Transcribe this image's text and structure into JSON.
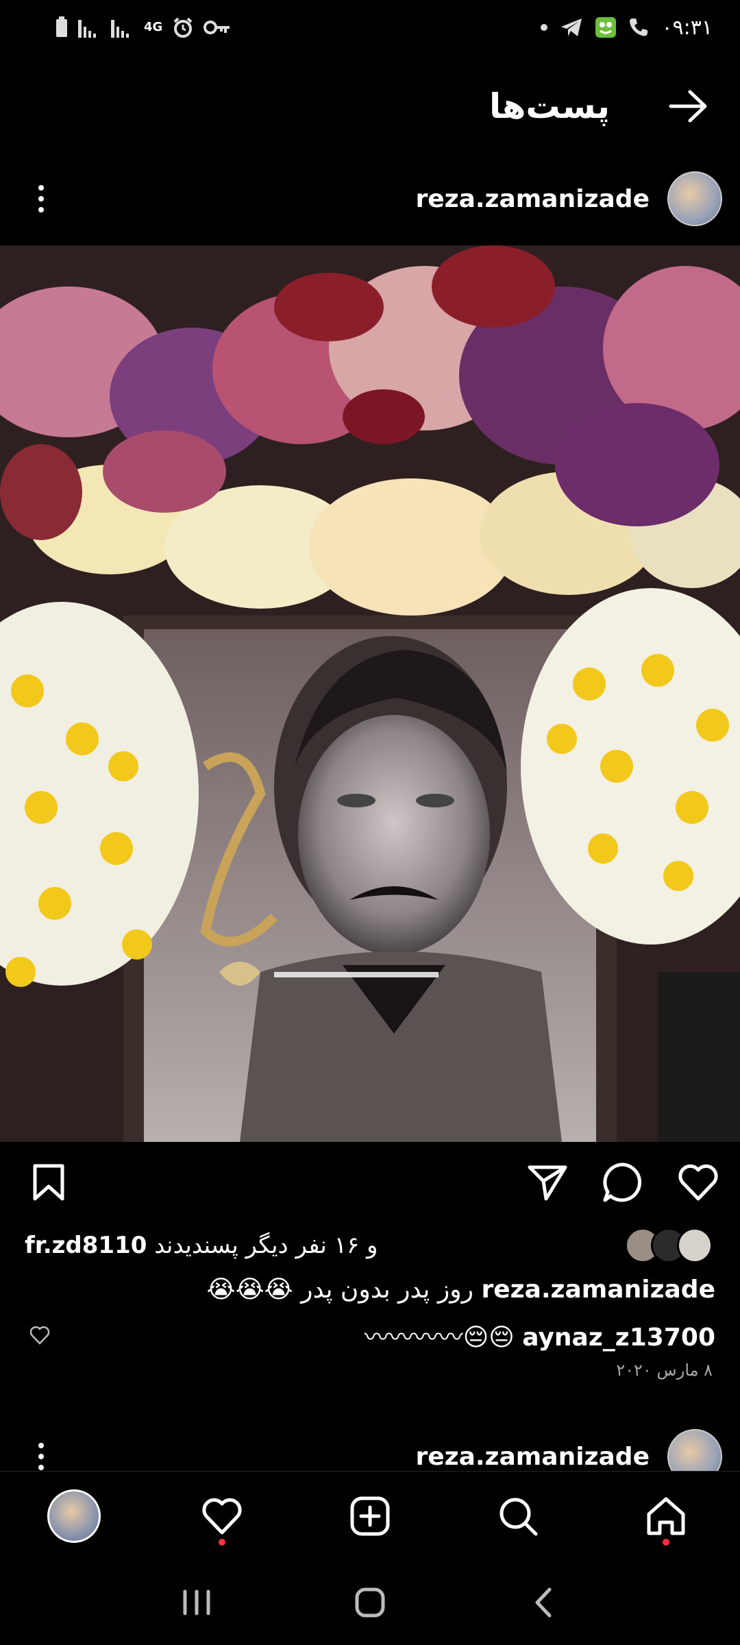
{
  "status_bar": {
    "time": "۰۹:۳۱",
    "network": "4G"
  },
  "header": {
    "title": "پست‌ها"
  },
  "post": {
    "username": "reza.zamanizade",
    "likes_prefix": "fr.zd8110",
    "likes_suffix": "و ۱۶ نفر دیگر پسندیدند",
    "caption_user": "reza.zamanizade",
    "caption_text": "روز پدر بدون پدر 😭😭😭",
    "comment_user": "aynaz_z13700",
    "comment_text": "😔😔〰〰〰〰",
    "date": "۸ مارس ۲۰۲۰"
  },
  "next_post": {
    "username": "reza.zamanizade"
  },
  "colors": {
    "notification_dot": "#ff3040",
    "secondary_text": "#a8a8a8"
  }
}
